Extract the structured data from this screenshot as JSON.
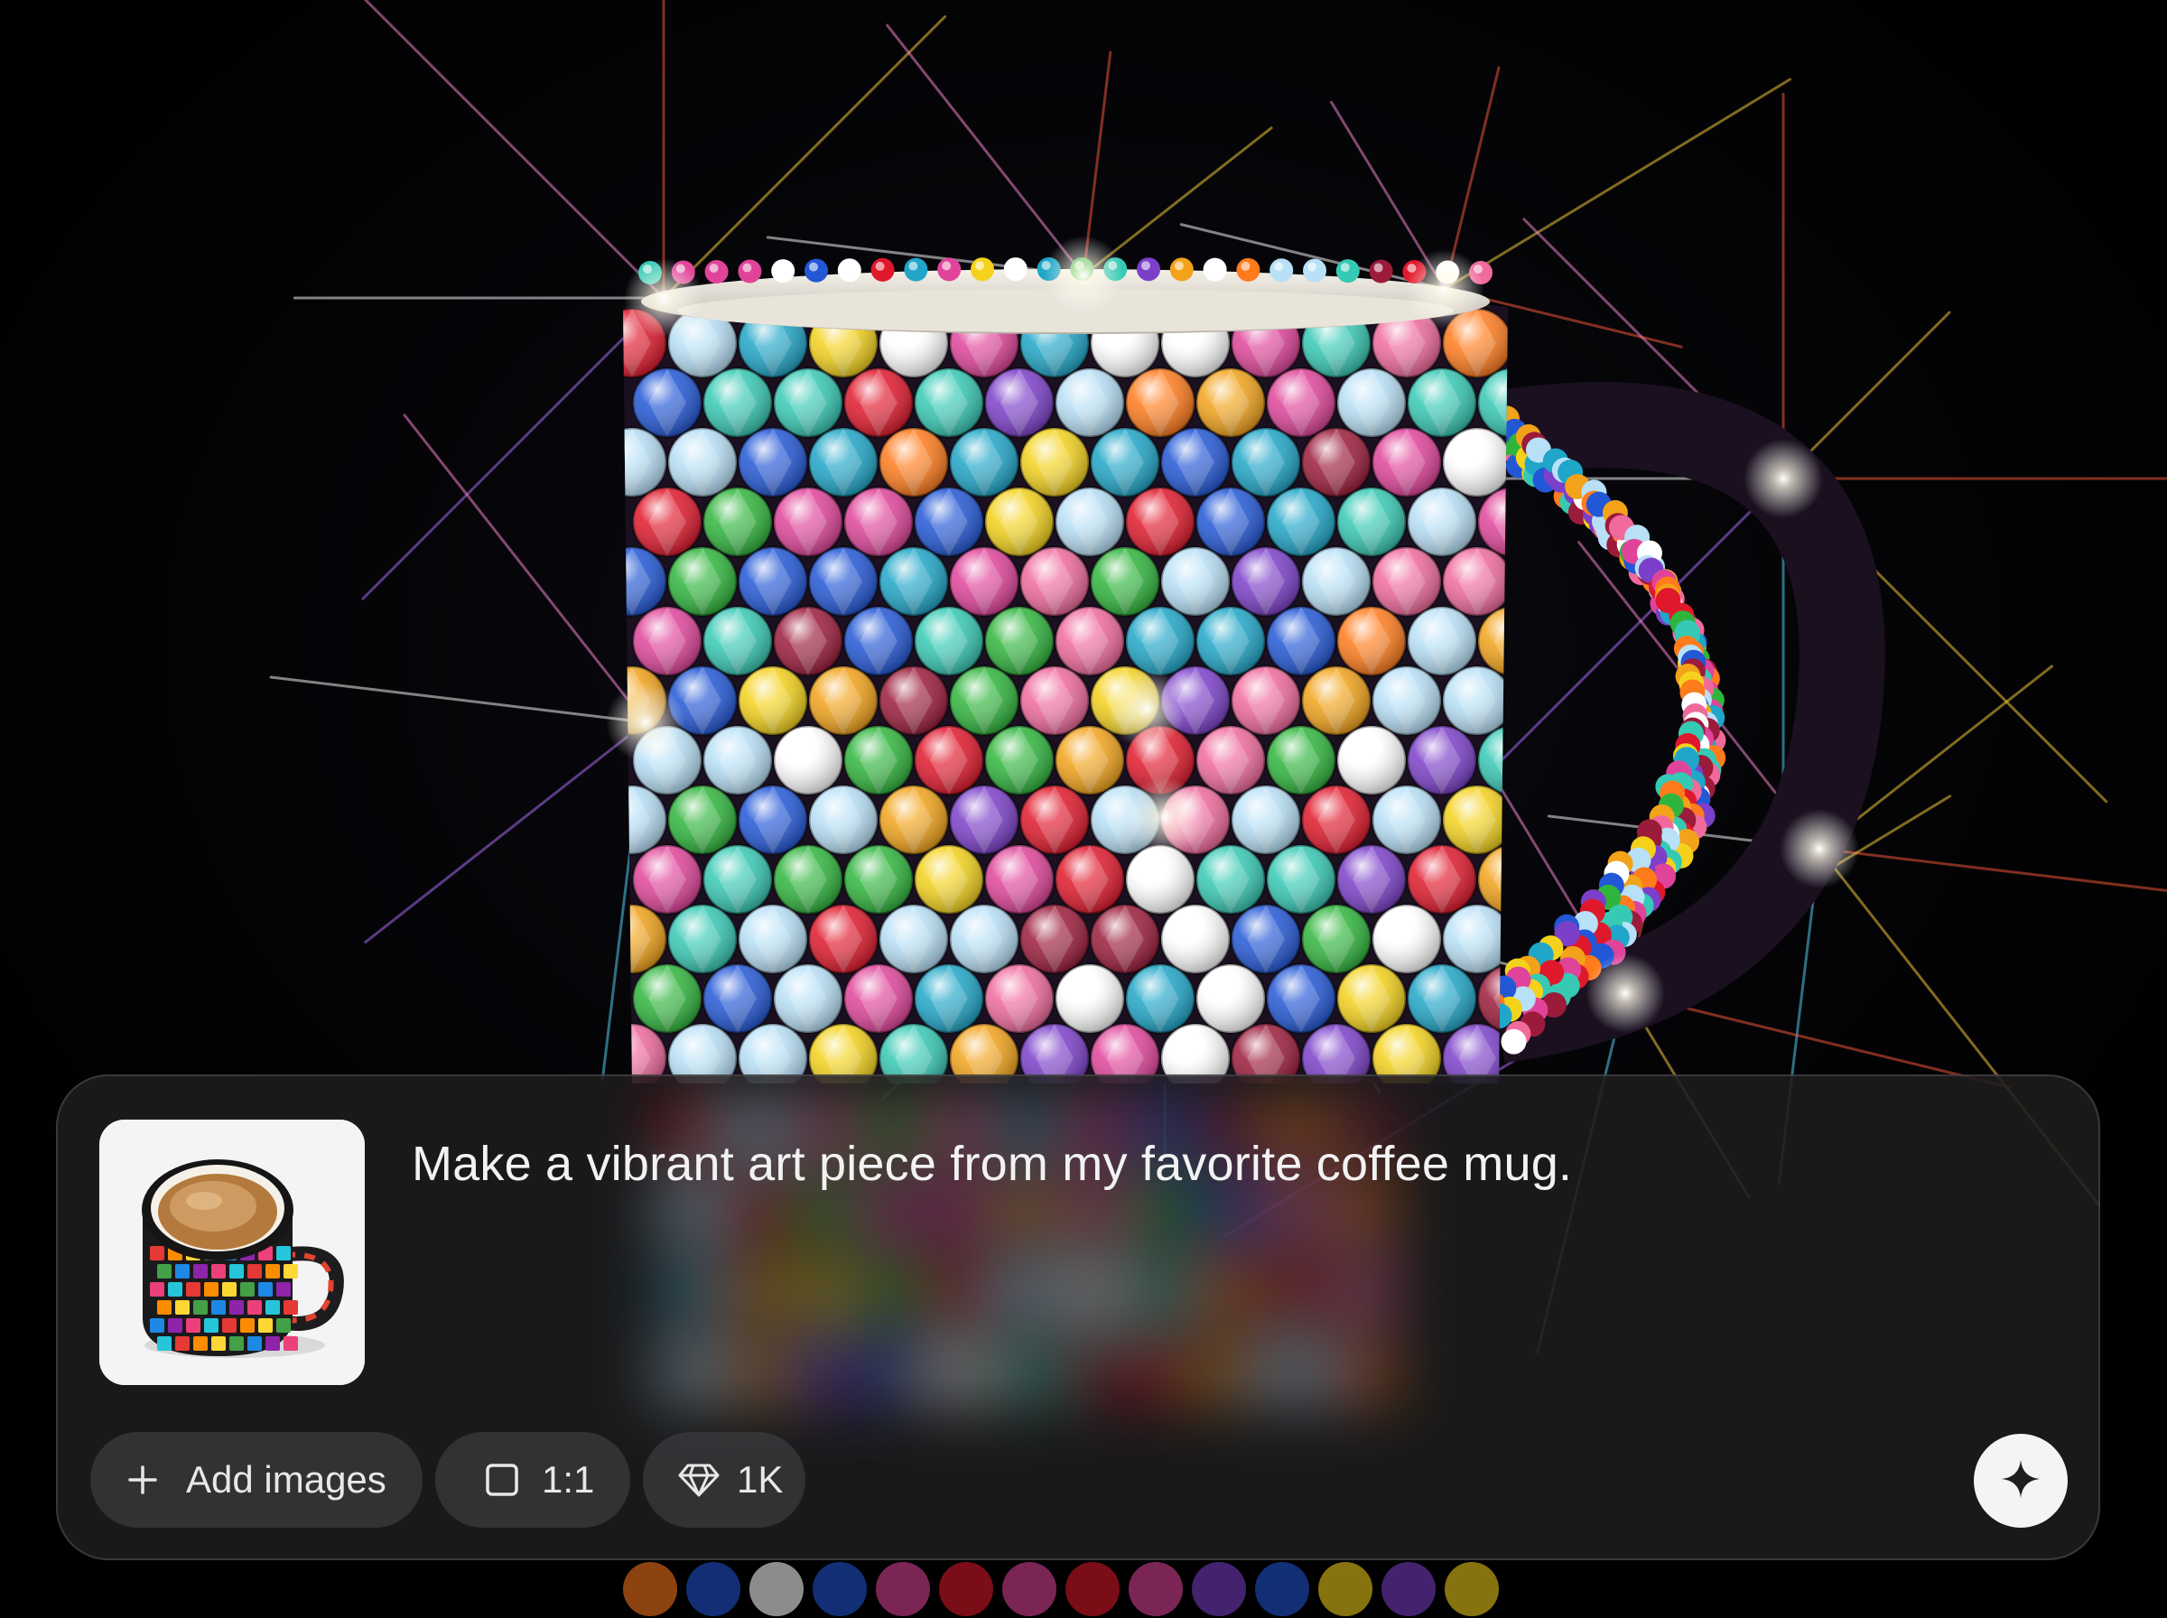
{
  "hero_image": {
    "subject": "crystal-covered-mug-artwork",
    "icon": "generated-image"
  },
  "prompt_panel": {
    "thumbnail": {
      "icon": "coffee-mug-photo"
    },
    "prompt_text": "Make a vibrant art piece from my favorite coffee mug.",
    "add_images": {
      "label": "Add images",
      "icon": "plus-icon"
    },
    "aspect_ratio": {
      "label": "1:1",
      "icon": "square-icon"
    },
    "resolution": {
      "label": "1K",
      "icon": "diamond-icon"
    },
    "generate_button": {
      "icon": "sparkle-icon"
    }
  },
  "colors": {
    "background": "#020203",
    "panel": "#1c1c1e",
    "chip": "#3c3c40",
    "text": "#f2f2f2",
    "button": "#f4f4f4"
  }
}
